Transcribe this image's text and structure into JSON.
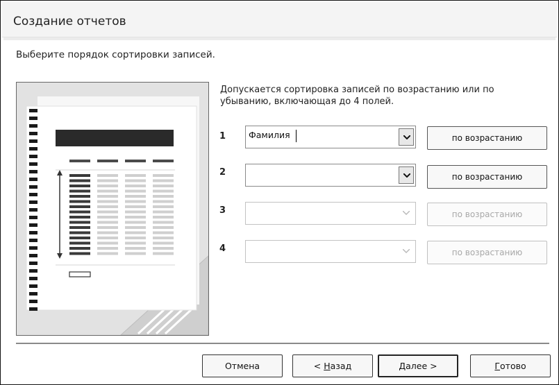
{
  "window": {
    "title": "Создание отчетов"
  },
  "instruction": "Выберите порядок сортировки записей.",
  "description": "Допускается сортировка записей по возрастанию или по убыванию, включающая до 4 полей.",
  "sort_rows": [
    {
      "number": "1",
      "field_value": "Фамилия",
      "order_label": "по возрастанию",
      "enabled": true
    },
    {
      "number": "2",
      "field_value": "",
      "order_label": "по возрастанию",
      "enabled": true
    },
    {
      "number": "3",
      "field_value": "",
      "order_label": "по возрастанию",
      "enabled": false
    },
    {
      "number": "4",
      "field_value": "",
      "order_label": "по возрастанию",
      "enabled": false
    }
  ],
  "buttons": {
    "cancel": "Отмена",
    "back_prefix": "< ",
    "back_accel": "Н",
    "back_rest": "азад",
    "next_accel": "Д",
    "next_rest": "алее >",
    "finish_accel": "Г",
    "finish_rest": "отово"
  },
  "icons": {
    "dropdown": "chevron-down-icon",
    "preview": "report-preview-illustration"
  }
}
